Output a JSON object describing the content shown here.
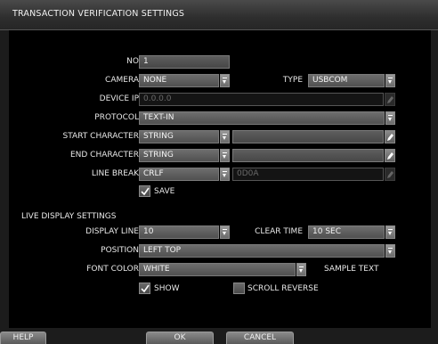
{
  "dialog": {
    "title": "TRANSACTION VERIFICATION SETTINGS"
  },
  "form": {
    "no": {
      "label": "NO",
      "value": "1"
    },
    "camera": {
      "label": "CAMERA",
      "value": "NONE"
    },
    "type": {
      "label": "TYPE",
      "value": "USBCOM"
    },
    "device_ip": {
      "label": "DEVICE IP",
      "value": "0.0.0.0"
    },
    "protocol": {
      "label": "PROTOCOL",
      "value": "TEXT-IN"
    },
    "start_character": {
      "label": "START CHARACTER",
      "value": "STRING",
      "text": ""
    },
    "end_character": {
      "label": "END CHARACTER",
      "value": "STRING",
      "text": ""
    },
    "line_break": {
      "label": "LINE BREAK",
      "value": "CRLF",
      "text": "0D0A"
    },
    "save": {
      "label": "SAVE",
      "checked": true
    }
  },
  "live_display": {
    "section_title": "LIVE DISPLAY SETTINGS",
    "display_line": {
      "label": "DISPLAY LINE",
      "value": "10"
    },
    "clear_time": {
      "label": "CLEAR TIME",
      "value": "10 SEC"
    },
    "position": {
      "label": "POSITION",
      "value": "LEFT TOP"
    },
    "font_color": {
      "label": "FONT COLOR",
      "value": "WHITE",
      "sample": "SAMPLE TEXT"
    },
    "show": {
      "label": "SHOW",
      "checked": true
    },
    "scroll_reverse": {
      "label": "SCROLL REVERSE",
      "checked": false
    }
  },
  "buttons": {
    "help": "HELP",
    "ok": "OK",
    "cancel": "CANCEL"
  },
  "icons": {
    "dropdown": "chevron-down-icon",
    "edit": "pencil-edit-icon",
    "check": "checkmark-icon"
  },
  "colors": {
    "panel": "#000000",
    "frame": "#1c1c1c",
    "field": "#5e5e5e",
    "text": "#e8e8e8"
  }
}
